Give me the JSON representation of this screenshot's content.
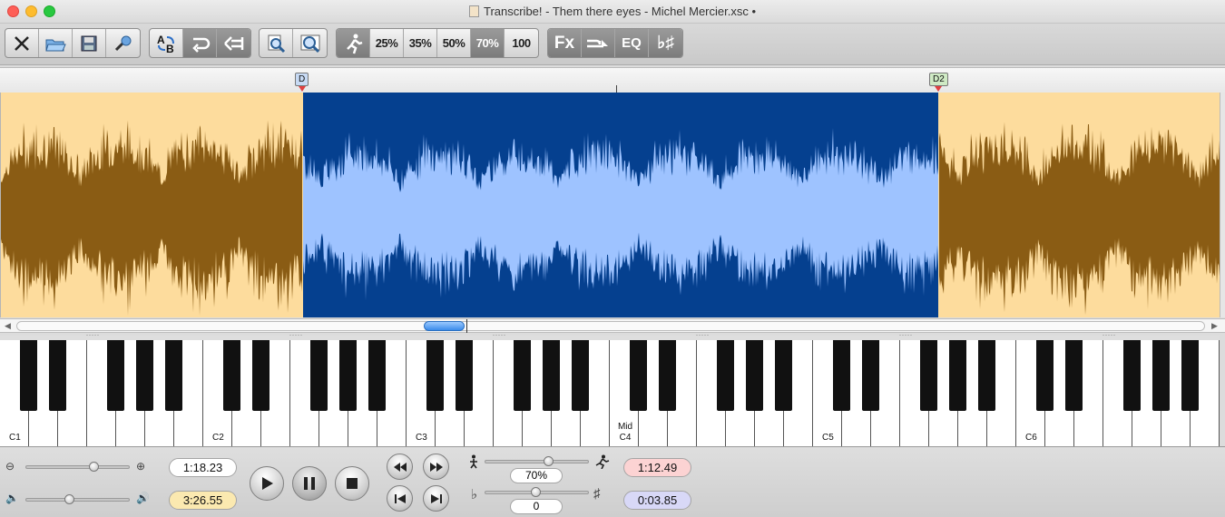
{
  "window": {
    "title": "Transcribe! - Them there eyes - Michel Mercier.xsc •"
  },
  "toolbar": {
    "file_group": [
      {
        "name": "close-icon",
        "label": ""
      },
      {
        "name": "open-folder-icon",
        "label": ""
      },
      {
        "name": "save-disk-icon",
        "label": ""
      },
      {
        "name": "properties-wrench-icon",
        "label": ""
      }
    ],
    "loop_group": [
      {
        "name": "ab-loop-icon",
        "label": ""
      },
      {
        "name": "loop-icon",
        "label": ""
      },
      {
        "name": "jump-back-icon",
        "label": ""
      }
    ],
    "zoom_group": [
      {
        "name": "zoom-in-icon",
        "label": ""
      },
      {
        "name": "zoom-fit-icon",
        "label": ""
      }
    ],
    "speed_group": [
      {
        "name": "running-speed-icon",
        "label": ""
      },
      {
        "name": "speed-25",
        "label": "25%"
      },
      {
        "name": "speed-35",
        "label": "35%"
      },
      {
        "name": "speed-50",
        "label": "50%"
      },
      {
        "name": "speed-70",
        "label": "70%",
        "active": true
      },
      {
        "name": "speed-100",
        "label": "100"
      }
    ],
    "fx_group": [
      {
        "name": "fx",
        "label": "Fx"
      },
      {
        "name": "filter-arrow-icon",
        "label": ""
      },
      {
        "name": "eq",
        "label": "EQ"
      },
      {
        "name": "flat-sharp",
        "label": "♭♯"
      }
    ]
  },
  "markers": [
    {
      "label": "D"
    },
    {
      "label": "D2"
    }
  ],
  "piano": {
    "labels": {
      "c1": "C1",
      "c2": "C2",
      "c3": "C3",
      "mid": "Mid",
      "c4": "C4",
      "c5": "C5",
      "c6": "C6"
    }
  },
  "controls": {
    "position_time": "1:18.23",
    "total_time": "3:26.55",
    "speed_value": "70%",
    "pitch_value": "0",
    "loop_start_time": "1:12.49",
    "loop_length_time": "0:03.85"
  },
  "colors": {
    "waveform_unselected": "#8a5c14",
    "waveform_unselected_bg": "#fddc9d",
    "waveform_selected": "#9ec3ff",
    "waveform_selected_bg": "#05408f"
  }
}
